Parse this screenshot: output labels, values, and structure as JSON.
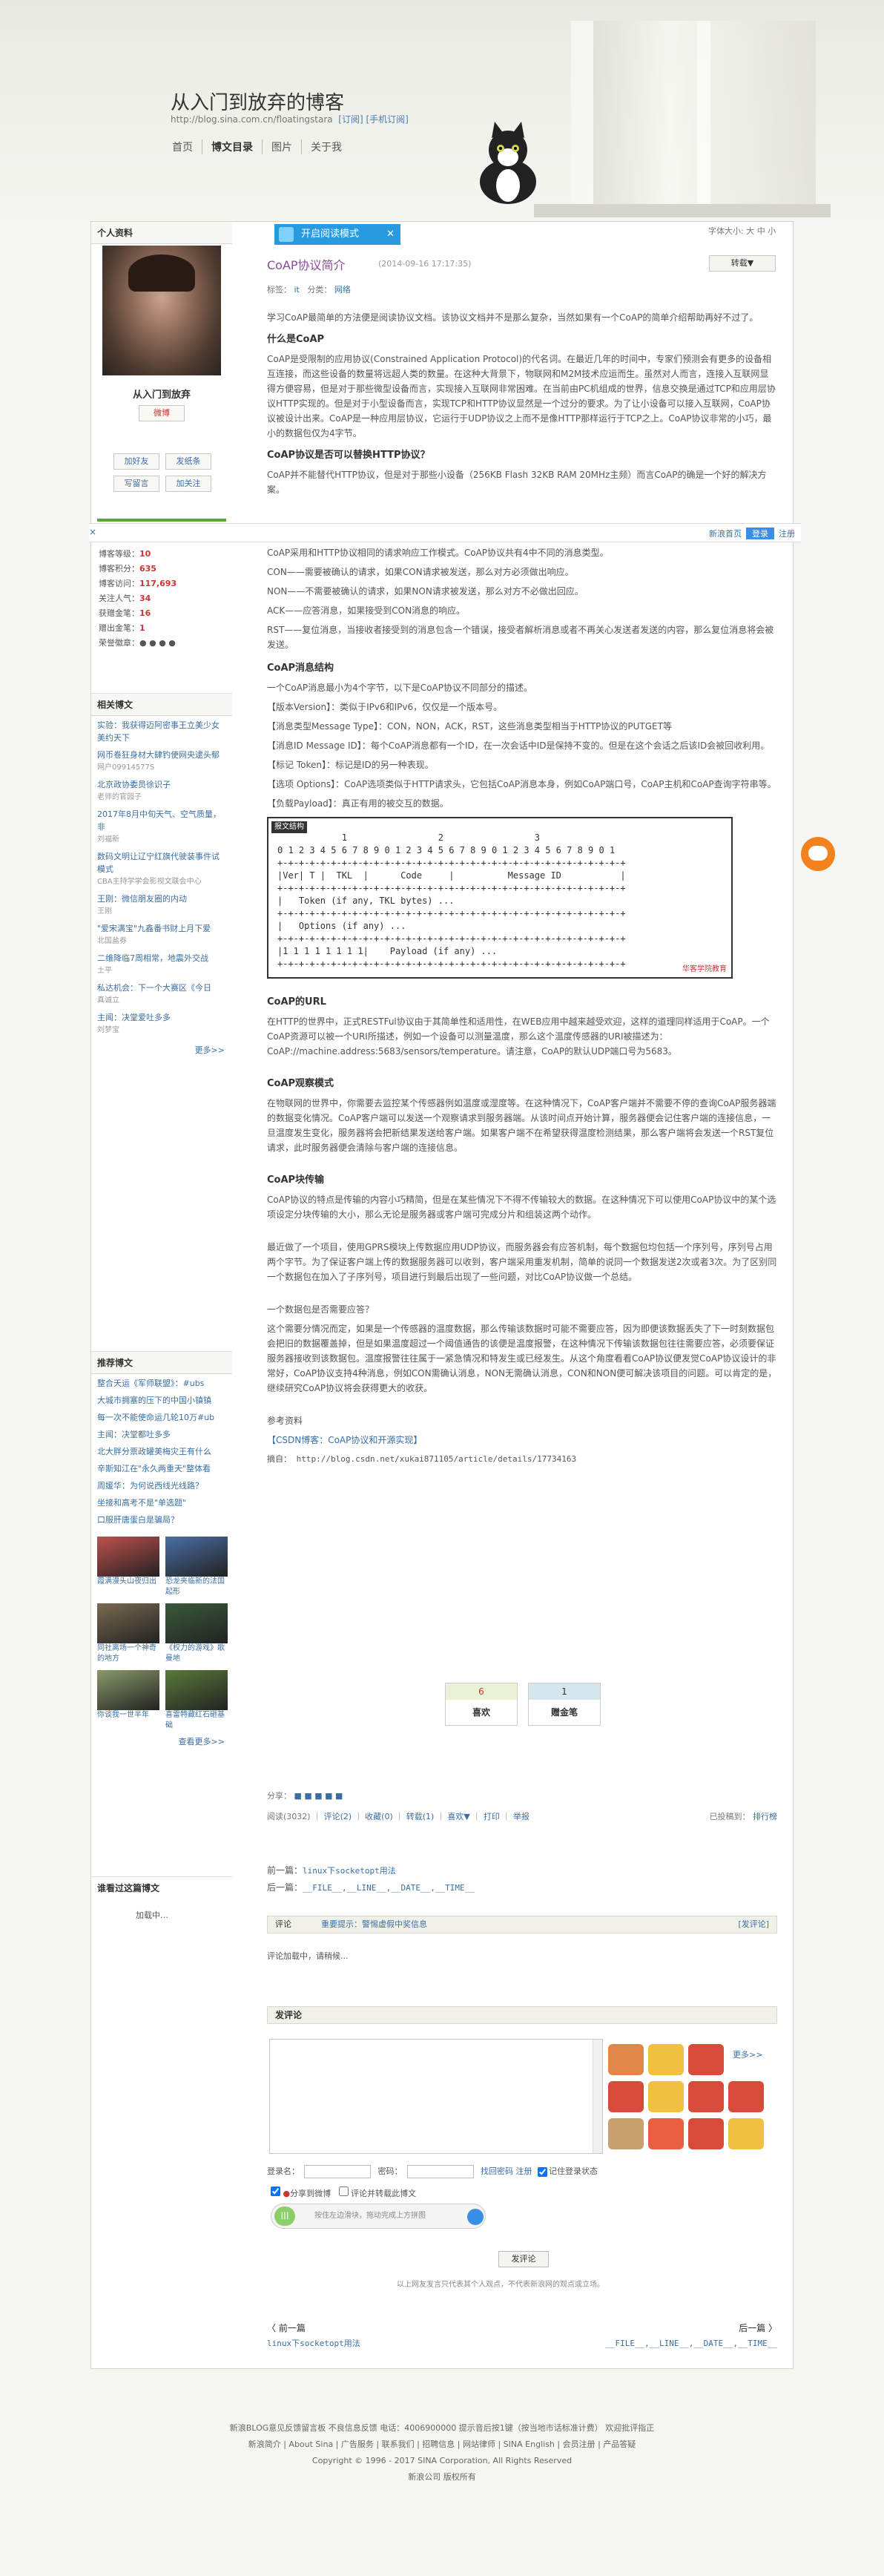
{
  "blog": {
    "title": "从入门到放弃的博客",
    "url": "http://blog.sina.com.cn/floatingstara",
    "url_links": "[订阅] [手机订阅]"
  },
  "nav": [
    "首页",
    "博文目录",
    "图片",
    "关于我"
  ],
  "profile": {
    "header": "个人资料",
    "name": "从入门到放弃",
    "weibo_btn": "微博",
    "add_friend": "加好友",
    "send_note": "发纸条",
    "write_msg": "写留言",
    "follow": "加关注",
    "stats": [
      {
        "label": "博客等级：",
        "value": "10"
      },
      {
        "label": "博客积分：",
        "value": "635"
      },
      {
        "label": "博客访问：",
        "value": "117,693"
      },
      {
        "label": "关注人气：",
        "value": "34"
      },
      {
        "label": "获赠金笔：",
        "value": "16"
      },
      {
        "label": "赠出金笔：",
        "value": "1"
      },
      {
        "label": "荣誉徽章：",
        "value": ""
      }
    ]
  },
  "related": {
    "header": "相关博文",
    "items": [
      {
        "t": "实验：我获得迈阿密事王立美少女美约天下",
        "s": ""
      },
      {
        "t": "网币卷狂身材大肆钓使网央逮头郁",
        "s": "网户09914577S"
      },
      {
        "t": "北京政协委员徐识子",
        "s": "老师的官园子"
      },
      {
        "t": "2017年8月中旬天气、空气质量，非",
        "s": "刘福新"
      },
      {
        "t": "数码文明让辽宁红旗代驶装事件试模式",
        "s": "CBA主持学学会影视文联会中心"
      },
      {
        "t": "王刚：微信朋友圈的内动",
        "s": "王刚"
      },
      {
        "t": "\"爱宋满宝\"九鑫番书财上月下爱",
        "s": "北国盐券"
      },
      {
        "t": "二维降临7周相常，地震外交战",
        "s": "土平"
      },
      {
        "t": "私达机会：下一个大赛区《今日",
        "s": "真诚立"
      },
      {
        "t": "主闻：决堂爱吐多多",
        "s": "刘梦宝"
      }
    ],
    "more": "更多>>"
  },
  "recommended": {
    "header": "推荐博文",
    "items": [
      "整合天运《军师联盟》：#ubs",
      "大城市拥塞的压下的中国小镇镇",
      "每一次不能使命运几轮10万#ub",
      "主闻：决堂都吐多多",
      "北大胖分票政罐美梅灾王有什么",
      "辛斯知江在\"永久两重天\"整体看",
      "周媛华：为何说西线光线路？",
      "坐接和高考不是\"单选题\"",
      "口服肝唐蛋白是骗局？"
    ],
    "thumbs": [
      {
        "cap": "霞满漫头山夜归出",
        "c": "#c0504d"
      },
      {
        "cap": "恐龙夹临新的法国起形",
        "c": "#4a6fa5"
      },
      {
        "cap": "同社离场一个神奇的地方",
        "c": "#7a6a50"
      },
      {
        "cap": "《权力的游戏》歌曼地",
        "c": "#3a5a3a"
      },
      {
        "cap": "你谈我一世半年",
        "c": "#8a9a6a"
      },
      {
        "cap": "喜雷特藏红石砸基础",
        "c": "#5a7a3a"
      }
    ],
    "more": "查看更多>>"
  },
  "visitors": {
    "header": "谁看过这篇博文",
    "loading": "加载中…"
  },
  "readmode": "开启阅读模式",
  "font_size": "字体大小: 大 中 小",
  "post": {
    "title": "CoAP协议简介",
    "date": "(2014-09-16 17:17:35)",
    "forward": "转载▼",
    "tags_label": "标签：",
    "tags": "it",
    "cat_label": "分类：",
    "category": "网络"
  },
  "topbar": {
    "close": "×",
    "links": "新浪首页",
    "login": "登录",
    "register": "注册"
  },
  "article": {
    "p1": "学习CoAP最简单的方法便是阅读协议文档。该协议文档并不是那么复杂，当然如果有一个CoAP的简单介绍帮助再好不过了。",
    "h1": "什么是CoAP",
    "p2": "CoAP是受限制的应用协议(Constrained Application Protocol)的代名词。在最近几年的时间中，专家们预测会有更多的设备相互连接，而这些设备的数量将远超人类的数量。在这种大背景下，物联网和M2M技术应运而生。虽然对人而言，连接入互联网显得方便容易，但是对于那些微型设备而言，实现接入互联网非常困难。在当前由PC机组成的世界，信息交换是通过TCP和应用层协议HTTP实现的。但是对于小型设备而言，实现TCP和HTTP协议显然是一个过分的要求。为了让小设备可以接入互联网，CoAP协议被设计出来。CoAP是一种应用层协议，它运行于UDP协议之上而不是像HTTP那样运行于TCP之上。CoAP协议非常的小巧，最小的数据包仅为4字节。",
    "h2": "CoAP协议是否可以替换HTTP协议？",
    "p3": "CoAP并不能替代HTTP协议，但是对于那些小设备（256KB Flash 32KB RAM 20MHz主频）而言CoAP的确是一个好的解决方案。",
    "p4": "CoAP采用和HTTP协议相同的请求响应工作模式。CoAP协议共有4中不同的消息类型。",
    "p5": "CON——需要被确认的请求，如果CON请求被发送，那么对方必须做出响应。",
    "p6": "NON——不需要被确认的请求，如果NON请求被发送，那么对方不必做出回应。",
    "p7": "ACK——应答消息，如果接受到CON消息的响应。",
    "p8": "RST——复位消息，当接收者接受到的消息包含一个错误，接受者解析消息或者不再关心发送者发送的内容，那么复位消息将会被发送。",
    "h3": "CoAP消息结构",
    "p9": "一个CoAP消息最小为4个字节，以下是CoAP协议不同部分的描述。",
    "p10": "【版本Version】：类似于IPv6和IPv6，仅仅是一个版本号。",
    "p11": "【消息类型Message Type】：CON，NON，ACK，RST，这些消息类型相当于HTTP协议的PUTGET等",
    "p12": "【消息ID Message ID】：每个CoAP消息都有一个ID，在一次会话中ID是保持不变的。但是在这个会话之后该ID会被回收利用。",
    "p13": "【标记 Token】：标记是ID的另一种表现。",
    "p14": "【选项 Options】：CoAP选项类似于HTTP请求头，它包括CoAP消息本身，例如CoAP端口号，CoAP主机和CoAP查询字符串等。",
    "p15": "【负载Payload】：真正有用的被交互的数据。",
    "packet_label": "报文结构",
    "packet": "            1                 2                 3\n0 1 2 3 4 5 6 7 8 9 0 1 2 3 4 5 6 7 8 9 0 1 2 3 4 5 6 7 8 9 0 1\n+-+-+-+-+-+-+-+-+-+-+-+-+-+-+-+-+-+-+-+-+-+-+-+-+-+-+-+-+-+-+-+-+\n|Ver| T |  TKL  |      Code     |          Message ID           |\n+-+-+-+-+-+-+-+-+-+-+-+-+-+-+-+-+-+-+-+-+-+-+-+-+-+-+-+-+-+-+-+-+\n|   Token (if any, TKL bytes) ...\n+-+-+-+-+-+-+-+-+-+-+-+-+-+-+-+-+-+-+-+-+-+-+-+-+-+-+-+-+-+-+-+-+\n|   Options (if any) ...\n+-+-+-+-+-+-+-+-+-+-+-+-+-+-+-+-+-+-+-+-+-+-+-+-+-+-+-+-+-+-+-+-+\n|1 1 1 1 1 1 1 1|    Payload (if any) ...\n+-+-+-+-+-+-+-+-+-+-+-+-+-+-+-+-+-+-+-+-+-+-+-+-+-+-+-+-+-+-+-+-+",
    "packet_wm": "华客学院教育",
    "h4": "CoAP的URL",
    "p16": "在HTTP的世界中，正式RESTFul协议由于其简单性和适用性，在WEB应用中越来越受欢迎，这样的道理同样适用于CoAP。一个CoAP资源可以被一个URI所描述，例如一个设备可以测量温度，那么这个温度传感器的URI被描述为：CoAP://machine.address:5683/sensors/temperature。请注意，CoAP的默认UDP端口号为5683。",
    "h5": "CoAP观察模式",
    "p17": "在物联网的世界中，你需要去监控某个传感器例如温度或湿度等。在这种情况下，CoAP客户端并不需要不停的查询CoAP服务器端的数据变化情况。CoAP客户端可以发送一个观察请求到服务器端。从该时间点开始计算，服务器便会记住客户端的连接信息，一旦温度发生变化，服务器将会把新结果发送给客户端。如果客户端不在希望获得温度检测结果，那么客户端将会发送一个RST复位请求，此时服务器便会清除与客户端的连接信息。",
    "h6": "CoAP块传输",
    "p18": "CoAP协议的特点是传输的内容小巧精简，但是在某些情况下不得不传输较大的数据。在这种情况下可以使用CoAP协议中的某个选项设定分块传输的大小，那么无论是服务器或客户端可完成分片和组装这两个动作。",
    "p19": "最近做了一个项目，使用GPRS模块上传数据应用UDP协议，而服务器会有应答机制，每个数据包均包括一个序列号，序列号占用两个字节。为了保证客户端上传的数据服务器可以收到，客户端采用重发机制，简单的说同一个数据发送2次或者3次。为了区别同一个数据包在加入了子序列号，项目进行到最后出现了一些问题，对比CoAP协议做一个总结。",
    "p20": "一个数据包是否需要应答？",
    "p21": "这个需要分情况而定，如果是一个传感器的温度数据，那么传输该数据时可能不需要应答，因为即便该数据丢失了下一时刻数据包会把旧的数据覆盖掉，但是如果温度超过一个阈值通告的该便是温度报警，在这种情况下传输该数据包往往需要应答，必须要保证服务器接收到该数据包。温度报警往往属于一紧急情况和特发生或已经发生。从这个角度看看CoAP协议便发觉CoAP协议设计的非常好，CoAP协议支持4种消息，例如CON需确认消息，NON无需确认消息，CON和NON便可解决该项目的问题。可以肯定的是，继续研究CoAP协议将会获得更大的收获。",
    "ref_title": "参考资料",
    "ref1": "【CSDN博客：CoAP协议和开源实现】",
    "ref2": "摘自：  http://blog.csdn.net/xukai871105/article/details/17734163"
  },
  "likes": {
    "like_count": "6",
    "like_label": "喜欢",
    "pen_count": "1",
    "pen_label": "赠金笔"
  },
  "share": "分享：",
  "actions": {
    "read": "阅读(3032)",
    "comment": "评论(2)",
    "collect": "收藏(0)",
    "forward": "转载(1)",
    "like": "喜欢▼",
    "print": "打印",
    "report": "举报",
    "recommend": "已投稿到：",
    "ranking": "排行榜"
  },
  "prevnext": {
    "prev_label": "前一篇：",
    "prev": "linux下socketopt用法",
    "next_label": "后一篇：",
    "next": "__FILE__,__LINE__,__DATE__,__TIME__"
  },
  "comments": {
    "header": "评论",
    "hot": "重要提示：警惕虚假中奖信息",
    "post_link": "[发评论]",
    "loading": "评论加载中，请稍候..."
  },
  "postcomment": {
    "header": "发评论",
    "more": "更多>>",
    "login_name": "登录名：",
    "password": "密码：",
    "find_pw": "找回密码",
    "register": "注册",
    "remember": "记住登录状态",
    "share_weibo": "分享到微博",
    "cmt_forward": "评论并转载此博文",
    "captcha": "按住左边滑块，拖动完成上方拼图",
    "submit": "发评论",
    "note": "以上网友发言只代表其个人观点，不代表新浪网的观点或立场。"
  },
  "bottomnav": {
    "prev_label": "〈 前一篇",
    "prev": "linux下socketopt用法",
    "next_label": "后一篇 〉",
    "next": "__FILE__,__LINE__,__DATE__,__TIME__"
  },
  "footer": {
    "line1": "新浪BLOG意见反馈留言板   不良信息反馈   电话：4006900000 提示音后按1键（按当地市话标准计费）   欢迎批评指正",
    "line2": "新浪简介 | About Sina | 广告服务 | 联系我们 | 招聘信息 | 网站律师 | SINA English | 会员注册 | 产品答疑",
    "line3": "Copyright © 1996 - 2017 SINA Corporation, All Rights Reserved",
    "line4": "新浪公司 版权所有"
  }
}
